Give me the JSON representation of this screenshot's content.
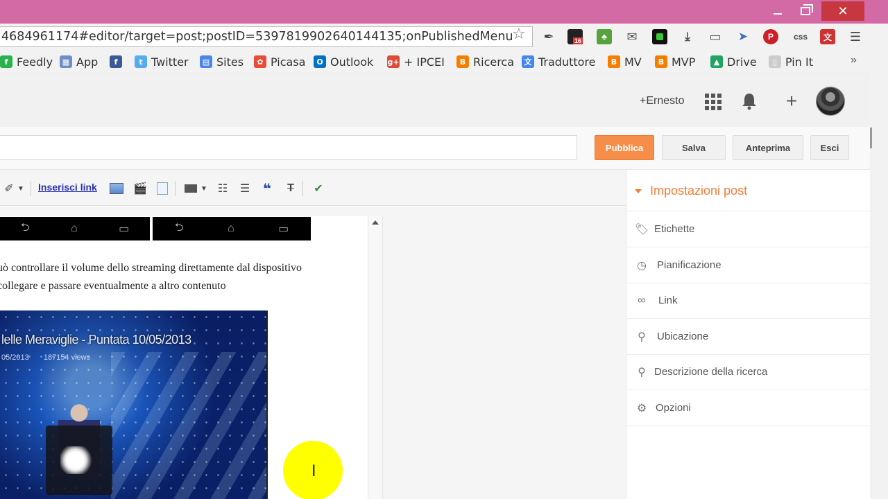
{
  "browser": {
    "url": "4684961174#editor/target=post;postID=5397819902640144135;onPublishedMenu",
    "extensions": [
      "dropper-icon",
      "mail-counter-icon",
      "evernote-icon",
      "gmail-icon",
      "green-square-icon",
      "download-icon",
      "cast-icon",
      "send-icon",
      "pinterest-icon",
      "css-icon",
      "translate-icon",
      "menu-icon"
    ],
    "extension_badge": "16",
    "css_label": "css"
  },
  "bookmarks": [
    {
      "label": "Feedly",
      "color": "#2bb24c",
      "glyph": "f"
    },
    {
      "label": "App",
      "color": "#6d8fc7",
      "glyph": "▦"
    },
    {
      "label": "",
      "color": "#3b5998",
      "glyph": "f"
    },
    {
      "label": "Twitter",
      "color": "#55acee",
      "glyph": "t"
    },
    {
      "label": "Sites",
      "color": "#4a86e8",
      "glyph": "▤"
    },
    {
      "label": "Picasa",
      "color": "#e94b35",
      "glyph": "✿"
    },
    {
      "label": "Outlook",
      "color": "#0072c6",
      "glyph": "O"
    },
    {
      "label": "+ IPCEI",
      "color": "#dd4b39",
      "glyph": "g+"
    },
    {
      "label": "Ricerca",
      "color": "#f57d00",
      "glyph": "B"
    },
    {
      "label": "Traduttore",
      "color": "#4285f4",
      "glyph": "文"
    },
    {
      "label": "MV",
      "color": "#f57d00",
      "glyph": "B"
    },
    {
      "label": "MVP",
      "color": "#f57d00",
      "glyph": "B"
    },
    {
      "label": "Drive",
      "color": "#1fa463",
      "glyph": "▲"
    },
    {
      "label": "Pin It",
      "color": "#cccccc",
      "glyph": "▯"
    }
  ],
  "bookmarks_more": "»",
  "gbar": {
    "user": "+Ernesto",
    "plus": "+"
  },
  "actions": {
    "publish": "Pubblica",
    "save": "Salva",
    "preview": "Anteprima",
    "exit": "Esci"
  },
  "editor_toolbar": {
    "link": "Inserisci link"
  },
  "editor": {
    "line1": "uò controllare il volume dello streaming direttamente dal dispositivo",
    "line2": "collegare e passare eventualmente a altro contenuto",
    "video_title": "lelle Meraviglie - Puntata 10/05/2013",
    "video_date": "05/2013",
    "video_views": "187154 views"
  },
  "sidebar": {
    "header": "Impostazioni post",
    "items": [
      {
        "label": "Etichette",
        "icon": "tag-icon"
      },
      {
        "label": "Pianificazione",
        "icon": "clock-icon"
      },
      {
        "label": "Link",
        "icon": "link-icon"
      },
      {
        "label": "Ubicazione",
        "icon": "location-pin-icon"
      },
      {
        "label": "Descrizione della ricerca",
        "icon": "search-icon"
      },
      {
        "label": "Opzioni",
        "icon": "gear-icon"
      }
    ]
  }
}
